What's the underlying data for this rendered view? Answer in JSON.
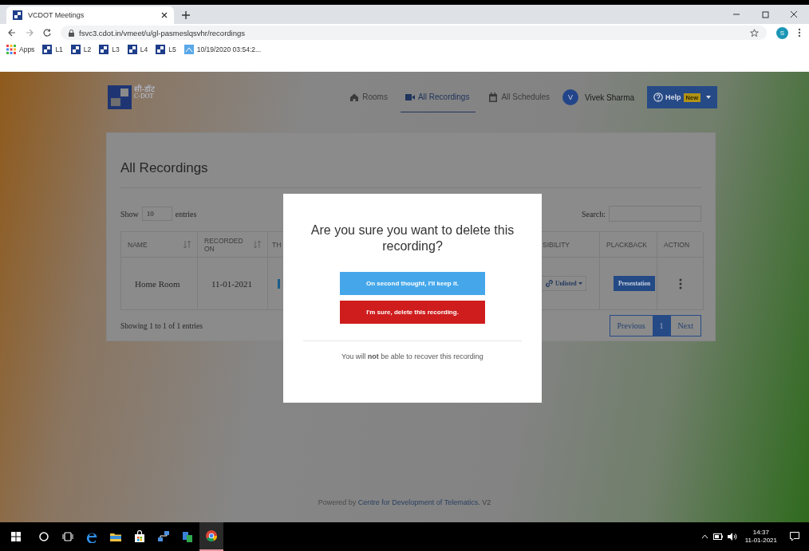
{
  "browser": {
    "tab_title": "VCDOT Meetings",
    "url": "fsvc3.cdot.in/vmeet/u/gl-pasmeslqsvhr/recordings",
    "profile_initial": "S",
    "bookmarks": [
      {
        "label": "Apps",
        "kind": "apps"
      },
      {
        "label": "L1",
        "kind": "site"
      },
      {
        "label": "L2",
        "kind": "site"
      },
      {
        "label": "L3",
        "kind": "site"
      },
      {
        "label": "L4",
        "kind": "site"
      },
      {
        "label": "L5",
        "kind": "site"
      },
      {
        "label": "10/19/2020 03:54:2...",
        "kind": "page"
      }
    ]
  },
  "header": {
    "logo_hindi": "सी-डॉट",
    "logo_english": "C-DOT",
    "nav": [
      {
        "label": "Rooms",
        "kind": "home",
        "selected": false
      },
      {
        "label": "All Recordings",
        "kind": "video",
        "selected": true
      },
      {
        "label": "All Schedules",
        "kind": "calendar",
        "selected": false
      }
    ],
    "user": {
      "initial": "V",
      "name": "Vivek Sharma"
    },
    "help": {
      "label": "Help",
      "badge": "New"
    }
  },
  "card": {
    "title": "All Recordings",
    "show_label": "Show",
    "page_size": "10",
    "entries_label": "entries",
    "search_label": "Search:",
    "columns": [
      {
        "label": "NAME",
        "sortable": true
      },
      {
        "label": "RECORDED ON",
        "sortable": true
      },
      {
        "label": "TH",
        "sortable": false
      },
      {
        "label": "SIBILITY",
        "sortable": false
      },
      {
        "label": "PLACKBACK",
        "sortable": false
      },
      {
        "label": "ACTION",
        "sortable": false
      }
    ],
    "rows": [
      {
        "name": "Home Room",
        "recorded_on": "11-01-2021",
        "visibility": "Unlisted",
        "playback": "Presentation"
      }
    ],
    "info": "Showing 1 to 1 of 1 entries",
    "pagination": [
      {
        "label": "Previous",
        "selected": false
      },
      {
        "label": "1",
        "selected": true
      },
      {
        "label": "Next",
        "selected": false
      }
    ]
  },
  "footer": {
    "prefix": "Powered by",
    "link": "Centre for Development of Telematics",
    "suffix": ". V2"
  },
  "modal": {
    "title": "Are you sure you want to delete this recording?",
    "keep_button": "On second thought, I'll keep it.",
    "delete_button": "I'm sure, delete this recording.",
    "note": "You will **not** be able to recover this recording"
  },
  "taskbar": {
    "apps": [
      {
        "kind": "search",
        "active": false
      },
      {
        "kind": "taskview",
        "active": false
      },
      {
        "kind": "edge",
        "active": false
      },
      {
        "kind": "folder",
        "active": false
      },
      {
        "kind": "store",
        "active": false
      },
      {
        "kind": "network",
        "active": false
      },
      {
        "kind": "phone",
        "active": false
      },
      {
        "kind": "chrome",
        "active": true
      }
    ],
    "time": "14:37",
    "date": "11-01-2021"
  }
}
